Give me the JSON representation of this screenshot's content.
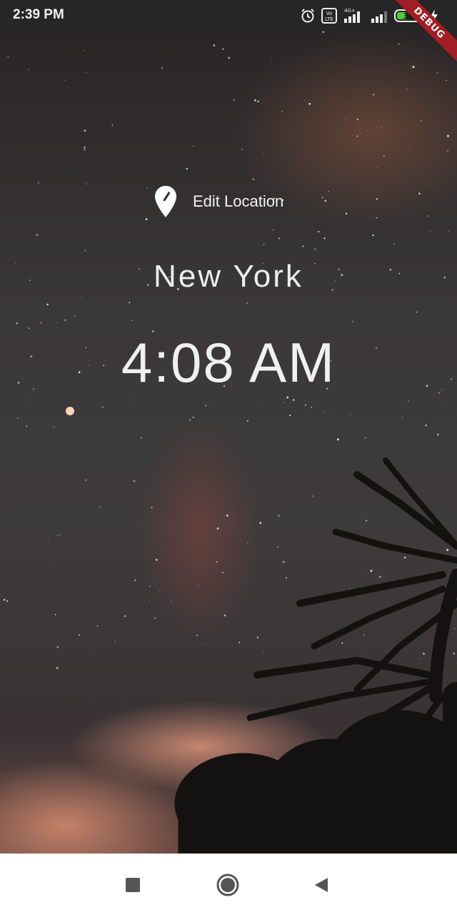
{
  "status_bar": {
    "time": "2:39 PM",
    "network_label": "4G+",
    "volte_label": "Vo LTE",
    "battery_level": "38",
    "icons": [
      "alarm-icon",
      "volte-icon",
      "signal-icon",
      "signal-icon-2",
      "battery-icon",
      "charging-icon"
    ]
  },
  "debug_banner": "DEBUG",
  "location": {
    "edit_label": "Edit Location",
    "icon": "location-edit-icon",
    "city": "New York",
    "time": "4:08 AM"
  },
  "nav_bar": {
    "icons": [
      "recents-icon",
      "home-icon",
      "back-icon"
    ]
  },
  "colors": {
    "status_bar_bg": "#262626",
    "text": "#f0f0f0",
    "debug_ribbon": "#a31d24",
    "nav_bg": "#ffffff",
    "nav_icon": "#555555"
  }
}
